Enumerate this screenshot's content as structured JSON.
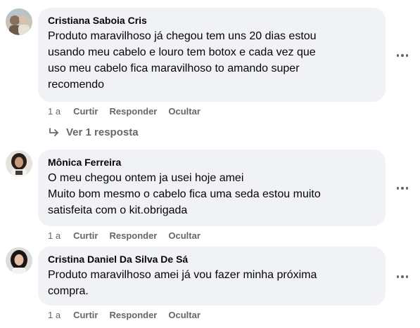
{
  "comments": [
    {
      "author": "Cristiana Saboia Cris",
      "text": "Produto maravilhoso já chegou tem uns 20 dias estou\nusando meu cabelo e louro tem botox e cada vez que\nuso meu cabelo fica maravilhoso to amando super\nrecomendo",
      "time": "1 a",
      "like": "Curtir",
      "reply": "Responder",
      "hide": "Ocultar",
      "view_replies": "Ver 1 resposta"
    },
    {
      "author": "Mônica Ferreira",
      "text": "O meu chegou ontem ja usei hoje amei\nMuito bom mesmo o cabelo fica uma seda estou muito\nsatisfeita com o kit.obrigada",
      "time": "1 a",
      "like": "Curtir",
      "reply": "Responder",
      "hide": "Ocultar"
    },
    {
      "author": "Cristina Daniel Da Silva De Sá",
      "text": "Produto maravilhoso amei já vou fazer minha próxima\ncompra.",
      "time": "1 a",
      "like": "Curtir",
      "reply": "Responder",
      "hide": "Ocultar"
    }
  ],
  "icons": {
    "more": "more-options-icon",
    "reply_arrow": "reply-arrow-icon"
  },
  "colors": {
    "bubble": "#f0f2f5",
    "secondary_text": "#65676b",
    "primary_text": "#050505"
  }
}
